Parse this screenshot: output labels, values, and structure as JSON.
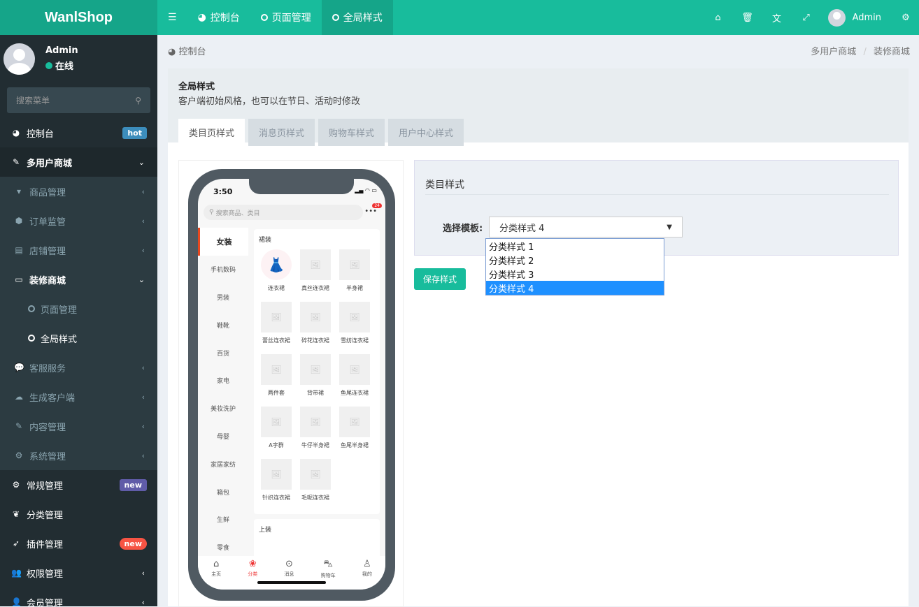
{
  "app": {
    "logo": "WanlShop"
  },
  "topnav": {
    "menu_icon": "bars-icon",
    "tabs": [
      {
        "label": "控制台",
        "icon": "dashboard-icon"
      },
      {
        "label": "页面管理",
        "icon": "circle-icon"
      },
      {
        "label": "全局样式",
        "icon": "circle-icon",
        "active": true
      }
    ],
    "right_icons": [
      "home-icon",
      "trash-icon",
      "translate-icon",
      "fullscreen-icon"
    ],
    "user": "Admin"
  },
  "sidebar": {
    "user": {
      "name": "Admin",
      "status": "在线"
    },
    "search_placeholder": "搜索菜单",
    "items": [
      {
        "label": "控制台",
        "badge": "hot"
      },
      {
        "label": "多用户商城"
      },
      {
        "label": "商品管理"
      },
      {
        "label": "订单监管"
      },
      {
        "label": "店铺管理"
      },
      {
        "label": "装修商城"
      },
      {
        "label": "页面管理"
      },
      {
        "label": "全局样式"
      },
      {
        "label": "客服服务"
      },
      {
        "label": "生成客户端"
      },
      {
        "label": "内容管理"
      },
      {
        "label": "系统管理"
      },
      {
        "label": "常规管理",
        "badge": "new"
      },
      {
        "label": "分类管理"
      },
      {
        "label": "插件管理",
        "badge": "new"
      },
      {
        "label": "权限管理"
      },
      {
        "label": "会员管理"
      }
    ]
  },
  "breadcrumb": {
    "home": "控制台",
    "path1": "多用户商城",
    "sep": "/",
    "path2": "装修商城"
  },
  "panel": {
    "title": "全局样式",
    "desc": "客户端初始风格，也可以在节日、活动时修改",
    "tabs": [
      "类目页样式",
      "消息页样式",
      "购物车样式",
      "用户中心样式"
    ]
  },
  "phone": {
    "time": "3:50",
    "search": "搜索商品、类目",
    "badge": "24",
    "categories": [
      "女装",
      "手机数码",
      "男装",
      "鞋靴",
      "百货",
      "家电",
      "美妆洗护",
      "母婴",
      "家居家纺",
      "箱包",
      "生鲜",
      "零食"
    ],
    "section1": "裙装",
    "items": [
      "连衣裙",
      "真丝连衣裙",
      "半身裙",
      "蕾丝连衣裙",
      "碎花连衣裙",
      "雪纺连衣裙",
      "两件套",
      "背带裙",
      "鱼尾连衣裙",
      "A字群",
      "牛仔半身裙",
      "鱼尾半身裙",
      "针织连衣裙",
      "毛呢连衣裙"
    ],
    "section2": "上装",
    "tabbar": [
      "主页",
      "分类",
      "消息",
      "购物车",
      "我的"
    ]
  },
  "form": {
    "title": "类目样式",
    "label": "选择模板:",
    "selected": "分类样式 4",
    "options": [
      "分类样式 1",
      "分类样式 2",
      "分类样式 3",
      "分类样式 4"
    ],
    "save": "保存样式"
  },
  "colors": {
    "primary": "#18bc9c",
    "sidebar": "#222d32",
    "hot": "#3c8dbc",
    "new_purple": "#605ca8",
    "new_red": "#f75444"
  }
}
